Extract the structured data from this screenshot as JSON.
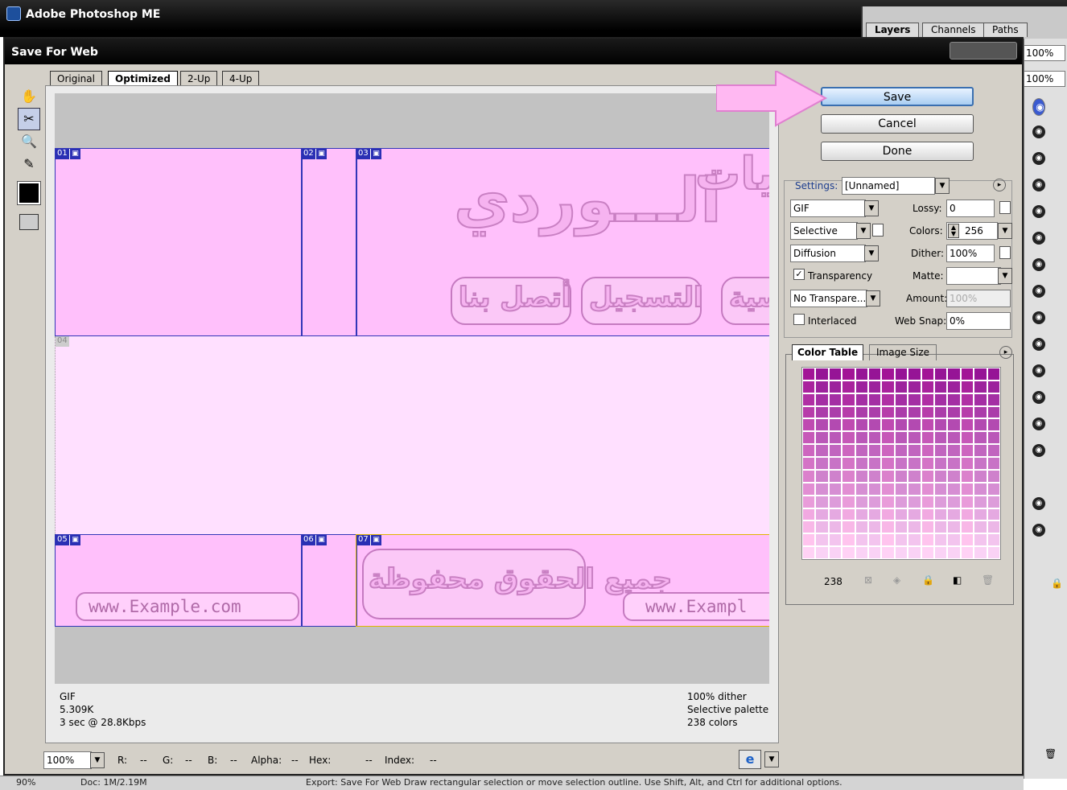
{
  "app": {
    "title": "Adobe Photoshop ME",
    "palette_tabs": [
      "Layers",
      "Channels",
      "Paths"
    ],
    "zoom_right": [
      "100%",
      "100%"
    ]
  },
  "status_bar": {
    "zoom": "90%",
    "doc": "Doc: 1M/2.19M",
    "hint": "Export: Save For Web Draw rectangular selection or move selection outline. Use Shift, Alt, and Ctrl for additional options."
  },
  "dialog": {
    "title": "Save For Web",
    "tabs": [
      "Original",
      "Optimized",
      "2-Up",
      "4-Up"
    ],
    "slices": [
      "01",
      "02",
      "03",
      "04",
      "05",
      "06",
      "07"
    ],
    "image_text": {
      "logo": "الـــوردي",
      "partial": "يات",
      "nav1": "أتصل بنا",
      "nav2": "التسجيل",
      "nav3": "سية",
      "footer": "جميع الحقوق محفوظة",
      "url1": "www.Example.com",
      "url2": "www.Exampl"
    },
    "info_left": [
      "GIF",
      "5.309K",
      "3 sec @ 28.8Kbps"
    ],
    "info_right": [
      "100% dither",
      "Selective palette",
      "238 colors"
    ],
    "bottom": {
      "zoom": "100%",
      "r": "R:",
      "r_val": "--",
      "g": "G:",
      "g_val": "--",
      "b": "B:",
      "b_val": "--",
      "alpha": "Alpha:",
      "alpha_val": "--",
      "hex": "Hex:",
      "hex_val": "--",
      "index": "Index:",
      "index_val": "--"
    },
    "buttons": {
      "save": "Save",
      "cancel": "Cancel",
      "done": "Done"
    },
    "settings": {
      "label": "Settings:",
      "preset": "[Unnamed]",
      "format": "GIF",
      "palette": "Selective",
      "dither_algo": "Diffusion",
      "transparency": "Transparency",
      "no_transparency": "No Transpare...",
      "interlaced": "Interlaced",
      "lossy_label": "Lossy:",
      "lossy": "0",
      "colors_label": "Colors:",
      "colors": "256",
      "dither_label": "Dither:",
      "dither": "100%",
      "matte_label": "Matte:",
      "matte": "",
      "amount_label": "Amount:",
      "amount": "100%",
      "websnap_label": "Web Snap:",
      "websnap": "0%"
    },
    "color_table": {
      "tab": "Color Table",
      "tab2": "Image Size",
      "count": "238"
    }
  },
  "colors": {
    "accent": "#ff80f0",
    "slice_line": "#3236b8",
    "image_bg": "#ffc0fb"
  }
}
